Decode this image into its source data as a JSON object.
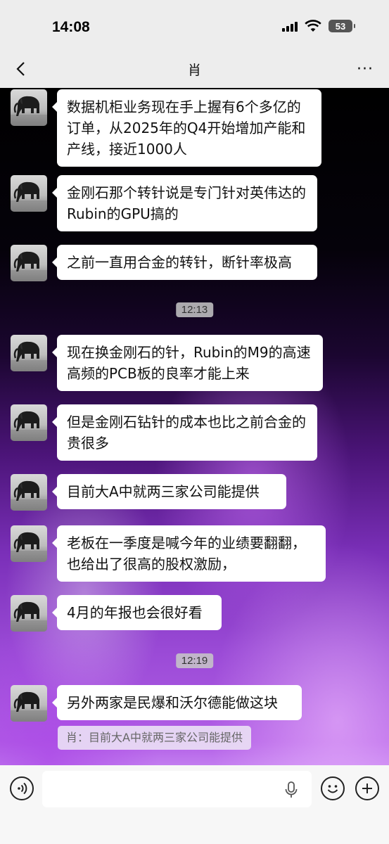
{
  "status_bar": {
    "time": "14:08",
    "battery": "53"
  },
  "nav": {
    "title": "肖",
    "more": "···"
  },
  "messages": [
    {
      "text": "数据机柜业务现在手上握有6个多亿的订单，从2025年的Q4开始增加产能和产线，接近1000人"
    },
    {
      "text": "金刚石那个转针说是专门针对英伟达的Rubin的GPU搞的"
    },
    {
      "text": "之前一直用合金的转针，断针率极高"
    },
    {
      "text": "现在换金刚石的针，Rubin的M9的高速高频的PCB板的良率才能上来"
    },
    {
      "text": "但是金刚石钻针的成本也比之前合金的贵很多"
    },
    {
      "text": "目前大A中就两三家公司能提供"
    },
    {
      "text": "老板在一季度是喊今年的业绩要翻翻，也给出了很高的股权激励，"
    },
    {
      "text": "4月的年报也会很好看"
    },
    {
      "text": "另外两家是民爆和沃尔德能做这块"
    }
  ],
  "timestamps": [
    "12:13",
    "12:19"
  ],
  "quote": "肖：目前大A中就两三家公司能提供",
  "input": {
    "placeholder": ""
  },
  "colors": {
    "bubble": "#ffffff",
    "header": "#ededed",
    "accent_purple": "#9a4ad6"
  }
}
